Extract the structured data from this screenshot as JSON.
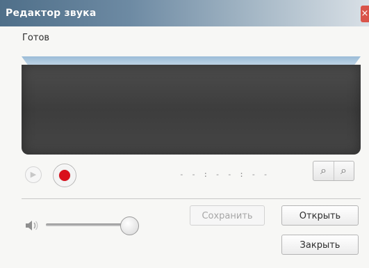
{
  "window": {
    "title": "Редактор звука",
    "close_symbol": "×"
  },
  "status": {
    "text": "Готов"
  },
  "transport": {
    "play_icon": "play-icon",
    "record_icon": "record-icon",
    "time_display": "- - : - - : - -"
  },
  "zoom": {
    "zoom_in_icon": "zoom-in-icon",
    "zoom_out_icon": "zoom-out-icon",
    "zoom_in_symbol": "⌕",
    "zoom_out_symbol": "⌕"
  },
  "volume": {
    "icon": "speaker-icon"
  },
  "buttons": {
    "save_label": "Сохранить",
    "open_label": "Открыть",
    "close_label": "Закрыть"
  },
  "colors": {
    "accent_record": "#d90f1b",
    "titlebar_blue": "#4f6f89"
  }
}
